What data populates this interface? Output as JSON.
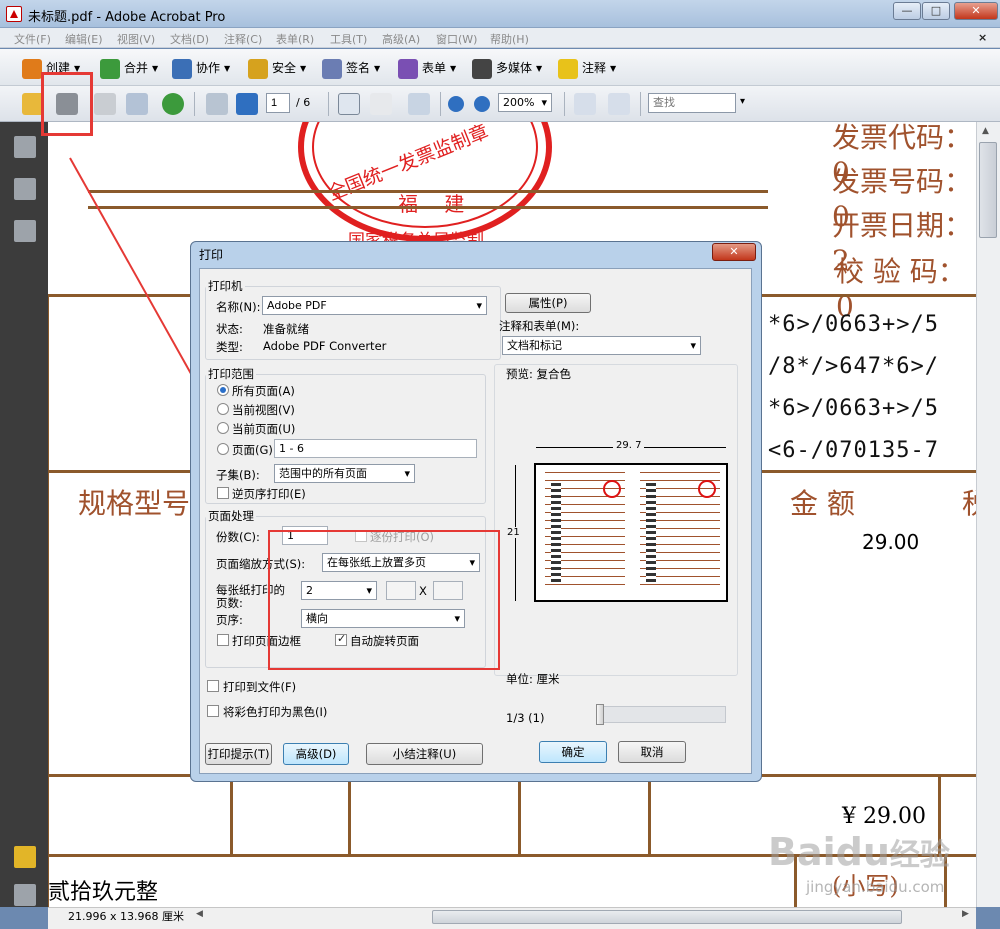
{
  "window": {
    "title": "未标题.pdf - Adobe Acrobat Pro",
    "buttons": {
      "minimize": "—",
      "maximize": "□",
      "close": "✕"
    }
  },
  "menu": {
    "items": [
      "文件(F)",
      "编辑(E)",
      "视图(V)",
      "文档(D)",
      "注释(C)",
      "表单(R)",
      "工具(T)",
      "高级(A)",
      "窗口(W)",
      "帮助(H)"
    ],
    "close": "×"
  },
  "toolbar1": {
    "items": [
      {
        "label": "创建",
        "icon": "create-icon",
        "color": "#e07b1a"
      },
      {
        "label": "合并",
        "icon": "combine-icon",
        "color": "#3c9a3c"
      },
      {
        "label": "协作",
        "icon": "collaborate-icon",
        "color": "#3b6fb6"
      },
      {
        "label": "安全",
        "icon": "lock-icon",
        "color": "#d6a21e"
      },
      {
        "label": "签名",
        "icon": "pen-icon",
        "color": "#6b7db3"
      },
      {
        "label": "表单",
        "icon": "form-icon",
        "color": "#7a4fb3"
      },
      {
        "label": "多媒体",
        "icon": "multimedia-icon",
        "color": "#444444"
      },
      {
        "label": "注释",
        "icon": "comment-icon",
        "color": "#e8c21a"
      }
    ]
  },
  "toolbar2": {
    "page_current": "1",
    "page_total": "/ 6",
    "zoom": "200%",
    "search_placeholder": "查找"
  },
  "document": {
    "stamp": {
      "line1": "全国统一发票监制章",
      "line2": "福 建",
      "line3": "国家税务总局监制"
    },
    "header_right": [
      "发票代码：0",
      "发票号码：0",
      "开票日期：2",
      "校 验 码：0"
    ],
    "codes": [
      "*6>/0663+>/5",
      "/8*/>647*6>/",
      "*6>/0663+>/5",
      "<6-/070135-7"
    ],
    "col_spec": "规格型号",
    "col_amount": "金 额",
    "col_tax": "税",
    "amount": "29.00",
    "total": "¥ 29.00",
    "words": "贰拾玖元整",
    "small": "(小写)"
  },
  "status": {
    "size": "21.996 x 13.968 厘米"
  },
  "watermark": {
    "brand": "Baidu",
    "brand2": "经验",
    "url": "jingyan.baidu.com"
  },
  "dialog": {
    "title": "打印",
    "printer": {
      "group": "打印机",
      "name_label": "名称(N):",
      "name_value": "Adobe PDF",
      "properties": "属性(P)",
      "status_label": "状态:",
      "status_value": "准备就绪",
      "type_label": "类型:",
      "type_value": "Adobe PDF Converter",
      "comments_label": "注释和表单(M):",
      "comments_value": "文档和标记"
    },
    "range": {
      "group": "打印范围",
      "all": "所有页面(A)",
      "current_view": "当前视图(V)",
      "current_page": "当前页面(U)",
      "pages": "页面(G)",
      "pages_value": "1 - 6",
      "subset_label": "子集(B):",
      "subset_value": "范围中的所有页面",
      "reverse": "逆页序打印(E)"
    },
    "handling": {
      "group": "页面处理",
      "copies_label": "份数(C):",
      "copies_value": "1",
      "collate": "逐份打印(O)",
      "scaling_label": "页面缩放方式(S):",
      "scaling_value": "在每张纸上放置多页",
      "per_sheet_label1": "每张纸打印的",
      "per_sheet_label2": "页数:",
      "per_sheet_value": "2",
      "x": "X",
      "order_label": "页序:",
      "order_value": "横向",
      "border": "打印页面边框",
      "autorotate": "自动旋转页面"
    },
    "print_to_file": "打印到文件(F)",
    "print_bw": "将彩色打印为黑色(I)",
    "preview": {
      "label": "预览: 复合色",
      "width": "29. 7",
      "height": "21",
      "unit": "单位: 厘米",
      "page": "1/3 (1)"
    },
    "buttons": {
      "tips": "打印提示(T)",
      "advanced": "高级(D)",
      "summarize": "小结注释(U)",
      "ok": "确定",
      "cancel": "取消"
    }
  }
}
